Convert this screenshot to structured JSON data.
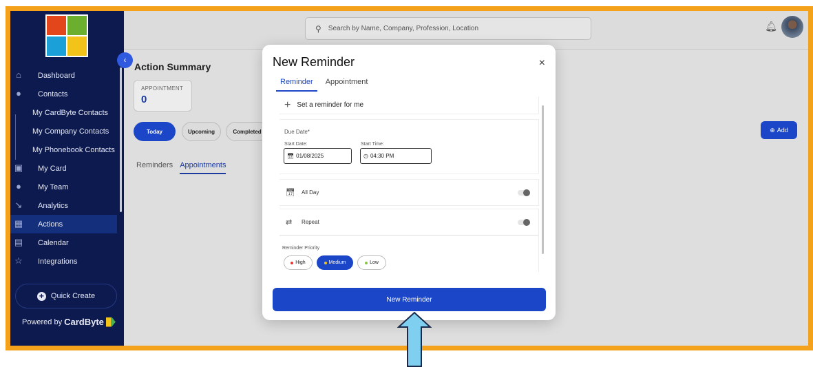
{
  "sidebar": {
    "logo_colors": [
      "#e2461a",
      "#6cae2e",
      "#1ba1d8",
      "#f2c318"
    ],
    "items": [
      {
        "label": "Dashboard",
        "icon": "home-icon",
        "sub": false,
        "active": false
      },
      {
        "label": "Contacts",
        "icon": "person-icon",
        "sub": false,
        "active": false
      },
      {
        "label": "My CardByte Contacts",
        "sub": true,
        "active": false
      },
      {
        "label": "My Company Contacts",
        "sub": true,
        "active": false
      },
      {
        "label": "My Phonebook Contacts",
        "sub": true,
        "active": false
      },
      {
        "label": "My Card",
        "icon": "id-card-icon",
        "sub": false,
        "active": false
      },
      {
        "label": "My Team",
        "icon": "team-icon",
        "sub": false,
        "active": false
      },
      {
        "label": "Analytics",
        "icon": "chart-icon",
        "sub": false,
        "active": false
      },
      {
        "label": "Actions",
        "icon": "actions-icon",
        "sub": false,
        "active": true
      },
      {
        "label": "Calendar",
        "icon": "calendar-icon",
        "sub": false,
        "active": false
      },
      {
        "label": "Integrations",
        "icon": "plug-icon",
        "sub": false,
        "active": false
      }
    ],
    "quick_create": "Quick Create",
    "powered_prefix": "Powered by",
    "powered_brand": "CardByte"
  },
  "header": {
    "search_placeholder": "Search by Name, Company, Profession, Location"
  },
  "main": {
    "title": "Action Summary",
    "appointment_label": "APPOINTMENT",
    "appointment_count": "0",
    "filters": [
      "Today",
      "Upcoming",
      "Completed"
    ],
    "add_label": "Add",
    "tabs": [
      "Reminders",
      "Appointments"
    ]
  },
  "modal": {
    "title": "New Reminder",
    "close": "×",
    "tabs": [
      "Reminder",
      "Appointment"
    ],
    "set_reminder": "Set a reminder for me",
    "due_date_label": "Due Date*",
    "start_date_label": "Start Date:",
    "start_date_value": "01/08/2025",
    "start_time_label": "Start Time:",
    "start_time_value": "04:30 PM",
    "all_day_label": "All Day",
    "all_day_on": false,
    "repeat_label": "Repeat",
    "repeat_on": false,
    "priority_label": "Reminder Priority",
    "priorities": [
      {
        "label": "High",
        "color": "#e53935",
        "selected": false
      },
      {
        "label": "Medium",
        "color": "#f2c318",
        "selected": true
      },
      {
        "label": "Low",
        "color": "#8bc34a",
        "selected": false
      }
    ],
    "submit_label": "New Reminder"
  },
  "colors": {
    "frame_border": "#f4a21c",
    "sidebar_bg": "#0d1a4f",
    "primary": "#1a46c7",
    "arrow": "#7fd0f0"
  }
}
